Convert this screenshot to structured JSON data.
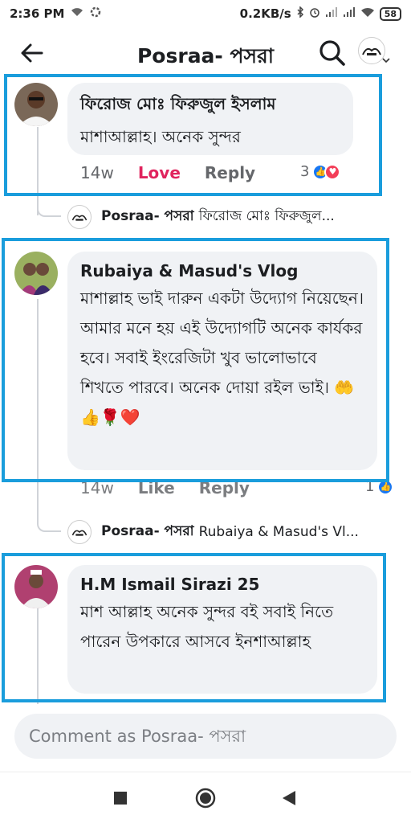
{
  "status_bar": {
    "time": "2:36 PM",
    "network_speed": "0.2KB/s",
    "battery": "58"
  },
  "header": {
    "title": "Posraa- পসরা"
  },
  "comments": [
    {
      "author": "ফিরোজ মোঃ ফিরুজুল ইসলাম",
      "text": "মাশাআল্লাহ। অনেক সুন্দর",
      "time": "14w",
      "reaction_action": "Love",
      "reply_label": "Reply",
      "reaction_count": "3"
    },
    {
      "author": "Rubaiya & Masud's Vlog",
      "text": "মাশাল্লাহ ভাই দারুন একটা উদ্যোগ নিয়েছেন। আমার মনে হয় এই উদ্যোগটি অনেক কার্যকর হবে। সবাই ইংরেজিটা খুব ভালোভাবে শিখতে পারবে। অনেক দোয়া রইল ভাই। 🤲 👍🌹❤️",
      "time": "14w",
      "reaction_action": "Like",
      "reply_label": "Reply",
      "reaction_count": "1"
    },
    {
      "author": "H.M Ismail Sirazi 25",
      "text": "মাশ আল্লাহ অনেক সুন্দর বই সবাই নিতে পারেন উপকারে আসবে ইনশাআল্লাহ"
    }
  ],
  "replies": [
    {
      "author": "Posraa- পসরা",
      "text": "ফিরোজ মোঃ ফিরুজুল..."
    },
    {
      "author": "Posraa- পসরা",
      "text": "Rubaiya & Masud's Vl..."
    }
  ],
  "comment_input": {
    "placeholder": "Comment as Posraa- পসরা"
  },
  "colors": {
    "highlight": "#1a9ddc",
    "love": "#e0245e",
    "like": "#1877f2",
    "bubble": "#f0f2f5"
  }
}
